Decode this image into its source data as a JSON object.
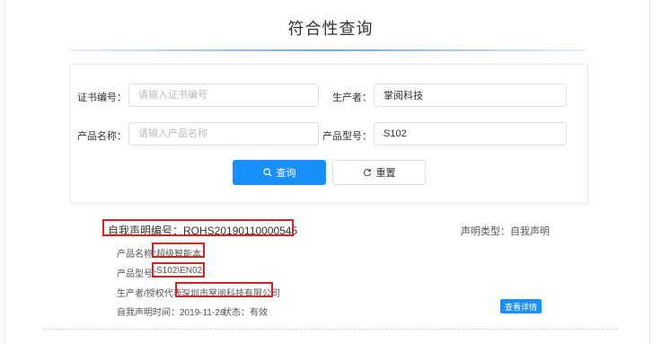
{
  "header": {
    "title": "符合性查询"
  },
  "search": {
    "cert_no": {
      "label": "证书编号：",
      "placeholder": "请输入证书编号",
      "value": ""
    },
    "producer": {
      "label": "生产者：",
      "placeholder": "",
      "value": "掌阅科技"
    },
    "product_name": {
      "label": "产品名称：",
      "placeholder": "请输入产品名称",
      "value": ""
    },
    "product_model": {
      "label": "产品型号：",
      "placeholder": "",
      "value": "S102"
    },
    "query_button": "查询",
    "reset_button": "重置"
  },
  "result": {
    "declaration_no": "自我声明编号：ROHS20190110000545",
    "declaration_type": "声明类型：自我声明",
    "product_name_label": "产品名称：",
    "product_name_value": "超级智能本",
    "product_model_label": "产品型号：",
    "product_model_value": "S102\\EN02",
    "producer_label": "生产者/授权代表：",
    "producer_value": "深圳市掌阅科技有限公司",
    "declaration_time": "自我声明时间：2019-11-28",
    "status": "状态：有效",
    "detail_button": "查看详情"
  },
  "colors": {
    "primary": "#1890ff",
    "highlight": "#e02020"
  }
}
